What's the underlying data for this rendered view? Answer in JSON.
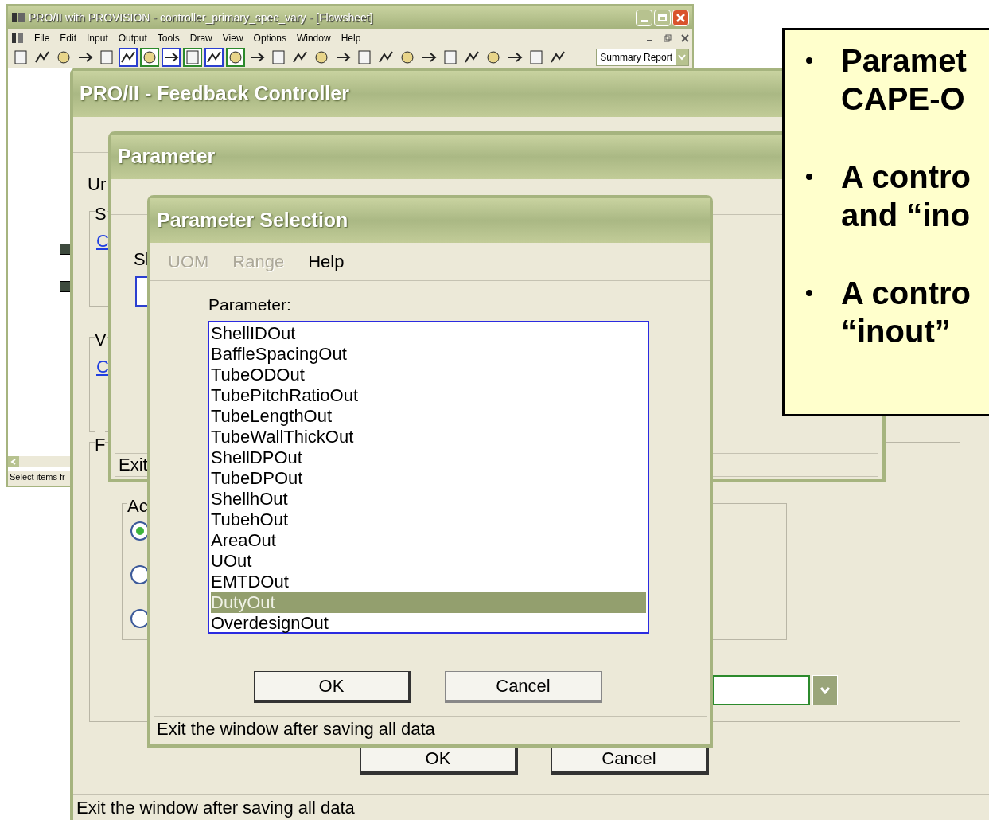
{
  "app_window": {
    "title": "PRO/II with PROVISION - controller_primary_spec_vary - [Flowsheet]",
    "menu": [
      "File",
      "Edit",
      "Input",
      "Output",
      "Tools",
      "Draw",
      "View",
      "Options",
      "Window",
      "Help"
    ],
    "report_dropdown": "Summary Report",
    "status_bar": "Select items fr"
  },
  "feedback_window": {
    "title": "PRO/II - Feedback Controller",
    "label_fragment": "Ur",
    "groups": [
      {
        "label": "S",
        "link": "C"
      },
      {
        "label": "V",
        "link": "C"
      }
    ],
    "outer_group": "F",
    "inner_group": "Ac",
    "radios": [
      {
        "selected": true
      },
      {
        "selected": false
      },
      {
        "selected": false
      }
    ],
    "buttons": [
      "OK",
      "Cancel"
    ],
    "status_bar": "Exit the window after saving all data"
  },
  "parameter_window": {
    "title": "Parameter",
    "label_fragment": "Sl",
    "status_bar": "Exit"
  },
  "selection_dialog": {
    "title": "Parameter Selection",
    "menu": [
      {
        "label": "UOM",
        "disabled": true
      },
      {
        "label": "Range",
        "disabled": true
      },
      {
        "label": "Help",
        "disabled": false
      }
    ],
    "list_label": "Parameter:",
    "items": [
      {
        "label": "ShellIDOut",
        "selected": false
      },
      {
        "label": "BaffleSpacingOut",
        "selected": false
      },
      {
        "label": "TubeODOut",
        "selected": false
      },
      {
        "label": "TubePitchRatioOut",
        "selected": false
      },
      {
        "label": "TubeLengthOut",
        "selected": false
      },
      {
        "label": "TubeWallThickOut",
        "selected": false
      },
      {
        "label": "ShellDPOut",
        "selected": false
      },
      {
        "label": "TubeDPOut",
        "selected": false
      },
      {
        "label": "ShellhOut",
        "selected": false
      },
      {
        "label": "TubehOut",
        "selected": false
      },
      {
        "label": "AreaOut",
        "selected": false
      },
      {
        "label": "UOut",
        "selected": false
      },
      {
        "label": "EMTDOut",
        "selected": false
      },
      {
        "label": "DutyOut",
        "selected": true
      },
      {
        "label": "OverdesignOut",
        "selected": false
      }
    ],
    "buttons": [
      "OK",
      "Cancel"
    ],
    "status_bar": "Exit the window after saving all data"
  },
  "note": {
    "bullets": [
      {
        "lines": [
          "Paramet",
          "CAPE-O"
        ]
      },
      {
        "lines": [
          "A contro",
          "and “ino"
        ]
      },
      {
        "lines": [
          "A contro",
          "“inout”"
        ]
      }
    ]
  }
}
